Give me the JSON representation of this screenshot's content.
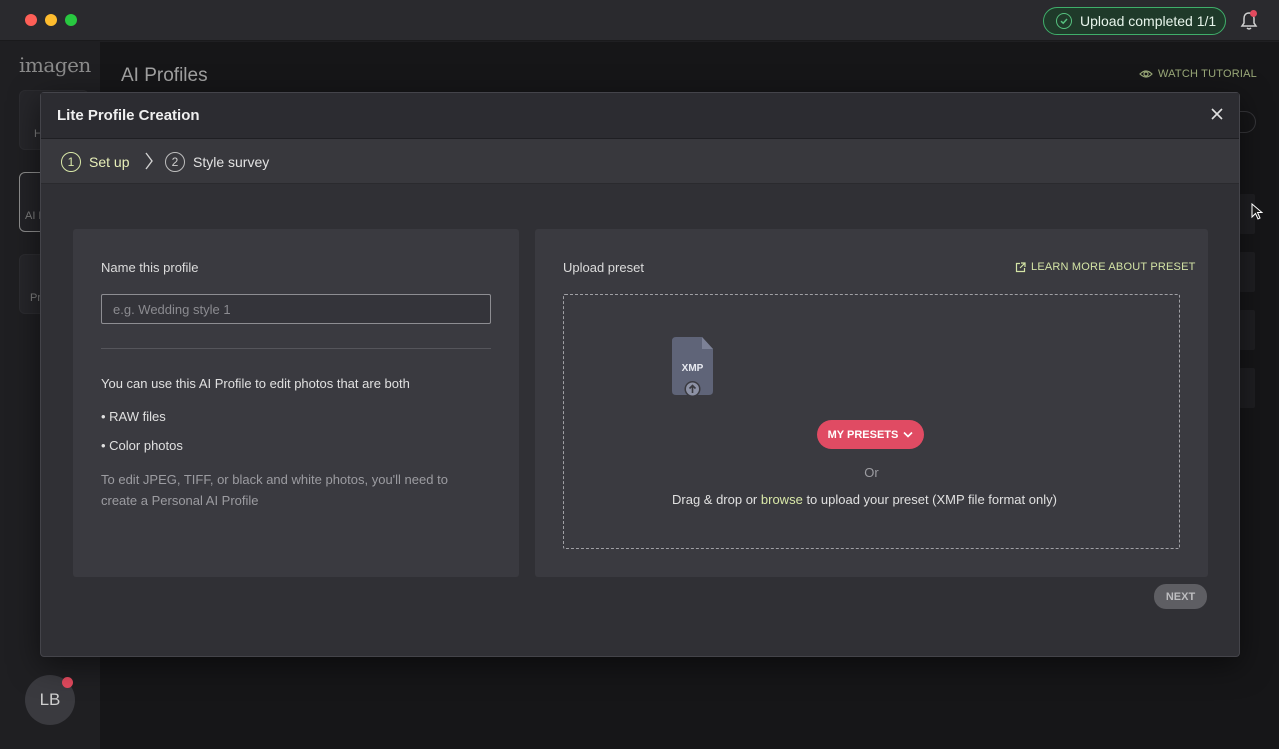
{
  "titlebar": {
    "upload_status": "Upload completed 1/1"
  },
  "sidebar": {
    "logo": "imagen",
    "items": [
      {
        "label": "H",
        "icon": "home-icon"
      },
      {
        "label": "AI P",
        "icon": "ai-profile-icon"
      },
      {
        "label": "Pr",
        "icon": "projects-icon"
      }
    ],
    "avatar_initials": "LB"
  },
  "page": {
    "title": "AI Profiles",
    "watch_tutorial": "WATCH TUTORIAL"
  },
  "modal": {
    "title": "Lite Profile Creation",
    "steps": [
      {
        "num": "1",
        "label": "Set up"
      },
      {
        "num": "2",
        "label": "Style survey"
      }
    ],
    "left_panel": {
      "name_label": "Name this profile",
      "name_placeholder": "e.g. Wedding style 1",
      "info_main": "You can use this AI Profile to edit photos that are both",
      "bullets": [
        "• RAW files",
        "• Color photos"
      ],
      "note": "To edit JPEG, TIFF, or black and white photos, you'll need to create a Personal AI Profile"
    },
    "right_panel": {
      "title": "Upload preset",
      "learn_more": "LEARN MORE ABOUT PRESET",
      "file_badge": "XMP",
      "presets_button": "MY PRESETS",
      "or_text": "Or",
      "drag_prefix": "Drag & drop or",
      "browse": "browse",
      "drag_suffix": "to upload your preset (XMP file format only)"
    },
    "next_button": "NEXT"
  },
  "colors": {
    "accent_green": "#d9e8a8",
    "presets_red": "#e04b63",
    "success_green": "#3fae6a"
  }
}
